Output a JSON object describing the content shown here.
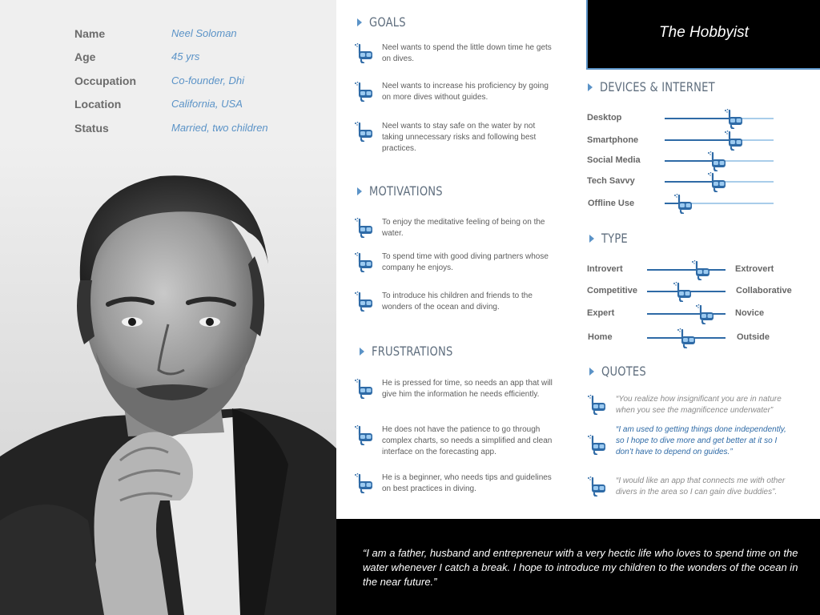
{
  "persona": {
    "title": "The Hobbyist",
    "info": [
      {
        "label": "Name",
        "value": "Neel Soloman"
      },
      {
        "label": "Age",
        "value": "45 yrs"
      },
      {
        "label": "Occupation",
        "value": "Co-founder, Dhi"
      },
      {
        "label": "Location",
        "value": "California, USA"
      },
      {
        "label": "Status",
        "value": "Married, two children"
      }
    ]
  },
  "goals": {
    "heading": "GOALS",
    "items": [
      "Neel wants to spend the little down time he gets on dives.",
      "Neel wants to increase his proficiency by going on more dives without guides.",
      "Neel wants to stay safe on the water by not taking unnecessary risks and following best practices."
    ]
  },
  "motivations": {
    "heading": "MOTIVATIONS",
    "items": [
      "To enjoy the meditative feeling of being on the water.",
      "To spend time with good diving partners whose company he enjoys.",
      "To introduce his children and friends to the wonders of the ocean and diving."
    ]
  },
  "frustrations": {
    "heading": "FRUSTRATIONS",
    "items": [
      "He is pressed for time, so needs an app that will give him the information he needs efficiently.",
      "He does not have the patience to go through complex charts, so needs a simplified and clean interface on the forecasting app.",
      "He is a beginner, who needs tips and guidelines on best practices in diving."
    ]
  },
  "devices": {
    "heading": "DEVICES & INTERNET",
    "items": [
      {
        "label": "Desktop",
        "level": 0.63
      },
      {
        "label": "Smartphone",
        "level": 0.63
      },
      {
        "label": "Social Media",
        "level": 0.48
      },
      {
        "label": "Tech Savvy",
        "level": 0.48
      },
      {
        "label": "Offline Use",
        "level": 0.17
      }
    ]
  },
  "type": {
    "heading": "TYPE",
    "items": [
      {
        "left": "Introvert",
        "right": "Extrovert",
        "position": 0.68
      },
      {
        "left": "Competitive",
        "right": "Collaborative",
        "position": 0.45
      },
      {
        "left": "Expert",
        "right": "Novice",
        "position": 0.73
      },
      {
        "left": "Home",
        "right": "Outside",
        "position": 0.5
      }
    ]
  },
  "quotes": {
    "heading": "QUOTES",
    "items": [
      {
        "text": "“You realize how insignificant you are in nature when you see the magnificence underwater”",
        "highlight": false
      },
      {
        "text": "“I am used to getting things done independently, so I hope to dive more and get better at it so I don’t have to depend on guides.”",
        "highlight": true
      },
      {
        "text": "“I would like an app that connects me with other divers in the area so I can gain dive buddies”.",
        "highlight": false
      }
    ]
  },
  "bio_quote": "“I am a father, husband and entrepreneur with a very hectic life who loves to spend time on the water whenever I catch a break. I hope to introduce my children to the wonders of the ocean in the near future.”",
  "colors": {
    "accent": "#5b93c7",
    "dark_blue": "#2e6aa6",
    "light_blue": "#a9cdea",
    "black": "#000000",
    "left_bg": "#efefef"
  },
  "icons": {
    "bullet": "snorkel-mask-icon",
    "section": "triangle-right-icon"
  }
}
